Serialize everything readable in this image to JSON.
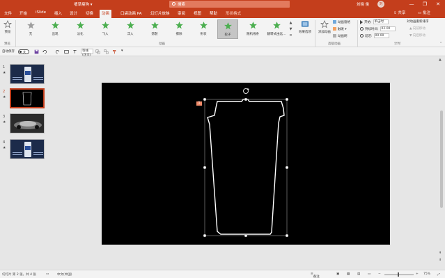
{
  "app": {
    "doc_title": "墙草瘦狗 ▾",
    "search_placeholder": "搜索",
    "user_name": "刘晓 俊",
    "user_initial": "刘",
    "window_buttons": [
      "—",
      "❐",
      "✕"
    ]
  },
  "tabs": [
    "文件",
    "开始",
    "iSlide",
    "插入",
    "设计",
    "切换",
    "动画",
    "口袋动画 PA",
    "幻灯片放映",
    "审阅",
    "视图",
    "帮助",
    "形状格式"
  ],
  "active_tab": "动画",
  "share_label": "共享",
  "comment_label": "批注",
  "ribbon": {
    "preview_label": "预览",
    "animations": [
      "无",
      "出现",
      "淡化",
      "飞入",
      "浮入",
      "劈裂",
      "擦除",
      "形状",
      "轮子",
      "随机线条",
      "翻转式由远..."
    ],
    "selected_animation": "轮子",
    "effect_options_label": "效果选项",
    "add_animation_label": "添加动画",
    "animation_pane_label": "动画窗格",
    "trigger_label": "触发",
    "painter_label": "动画刷",
    "start_label": "开始:",
    "start_value": "单击时",
    "duration_label": "持续时间:",
    "duration_value": "02.00",
    "delay_label": "延迟:",
    "delay_value": "00.00",
    "reorder_label": "对动画重新排序",
    "move_earlier": "向前移动",
    "move_later": "向后移动",
    "groups": {
      "preview": "预览",
      "animation": "动画",
      "advanced": "高级动画",
      "timing": "计时"
    }
  },
  "qat": {
    "autosave_label": "自动保存",
    "toggle_label": "关",
    "font_value": "等线 (正文)"
  },
  "thumbnails": [
    {
      "num": "1",
      "star": "★"
    },
    {
      "num": "2",
      "star": "★"
    },
    {
      "num": "3",
      "star": "★"
    },
    {
      "num": "4",
      "star": "★"
    }
  ],
  "selected_slide": "2",
  "slide": {
    "tag_label": "1"
  },
  "status": {
    "slide_info": "幻灯片 第 2 张，共 4 张",
    "language": "中文(中国)",
    "notes_label": "备注",
    "zoom": "75%"
  },
  "colors": {
    "accent": "#c43e1c",
    "slide_bg": "#000000",
    "star_green": "#4caf50"
  }
}
